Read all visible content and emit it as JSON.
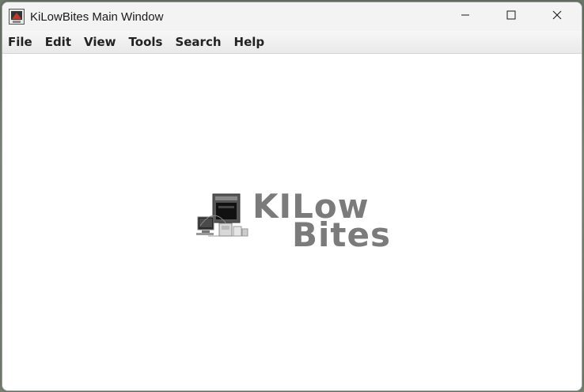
{
  "window": {
    "title": "KiLowBites Main Window"
  },
  "menubar": {
    "items": [
      {
        "label": "File"
      },
      {
        "label": "Edit"
      },
      {
        "label": "View"
      },
      {
        "label": "Tools"
      },
      {
        "label": "Search"
      },
      {
        "label": "Help"
      }
    ]
  },
  "logo": {
    "line1": "KILow",
    "line2": "Bites",
    "text_color": "#7b7b7b"
  },
  "icons": {
    "app": "app-logo-icon",
    "minimize": "minimize-icon",
    "maximize": "maximize-icon",
    "close": "close-icon"
  }
}
